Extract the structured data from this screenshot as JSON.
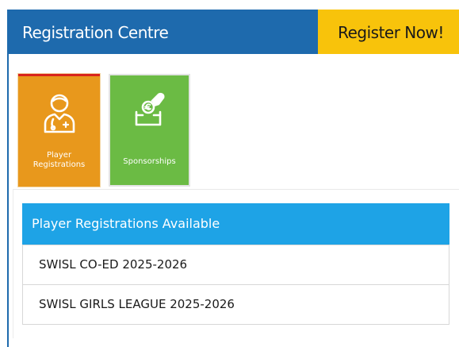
{
  "header": {
    "title": "Registration Centre",
    "register_label": "Register Now!"
  },
  "tiles": [
    {
      "label_line1": "Player",
      "label_line2": "Registrations",
      "icon": "player-icon",
      "color": "#e8981c"
    },
    {
      "label": "Sponsorships",
      "icon": "sponsorship-icon",
      "color": "#6bbb44"
    }
  ],
  "registrations": {
    "heading": "Player Registrations Available",
    "items": [
      "SWISL CO-ED 2025-2026",
      "SWISL GIRLS LEAGUE 2025-2026"
    ]
  },
  "colors": {
    "header_bg": "#1e6aad",
    "register_bg": "#f8c30b",
    "panel_header_bg": "#1ea3e6",
    "active_tile_border": "#d9241b"
  }
}
